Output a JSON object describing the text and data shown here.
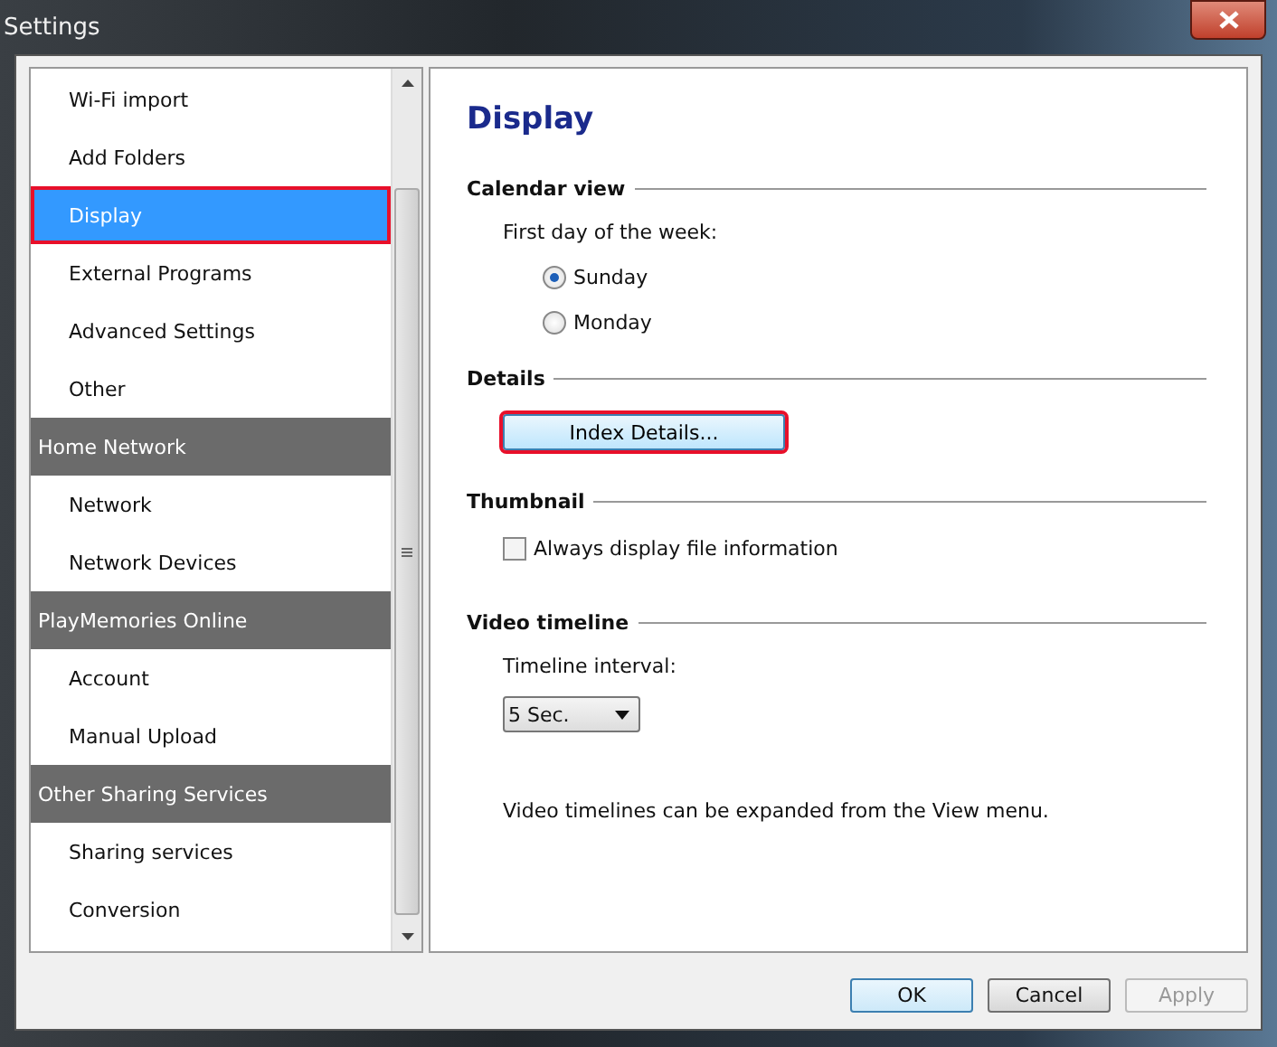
{
  "window": {
    "title": "Settings"
  },
  "sidebar": {
    "items": [
      {
        "kind": "item",
        "label": "Wi-Fi import",
        "selected": false,
        "highlighted": false
      },
      {
        "kind": "item",
        "label": "Add Folders",
        "selected": false,
        "highlighted": false
      },
      {
        "kind": "item",
        "label": "Display",
        "selected": true,
        "highlighted": true
      },
      {
        "kind": "item",
        "label": "External Programs",
        "selected": false,
        "highlighted": false
      },
      {
        "kind": "item",
        "label": "Advanced Settings",
        "selected": false,
        "highlighted": false
      },
      {
        "kind": "item",
        "label": "Other",
        "selected": false,
        "highlighted": false
      },
      {
        "kind": "header",
        "label": "Home Network"
      },
      {
        "kind": "item",
        "label": "Network",
        "selected": false,
        "highlighted": false
      },
      {
        "kind": "item",
        "label": "Network Devices",
        "selected": false,
        "highlighted": false
      },
      {
        "kind": "header",
        "label": "PlayMemories Online"
      },
      {
        "kind": "item",
        "label": "Account",
        "selected": false,
        "highlighted": false
      },
      {
        "kind": "item",
        "label": "Manual Upload",
        "selected": false,
        "highlighted": false
      },
      {
        "kind": "header",
        "label": "Other Sharing Services"
      },
      {
        "kind": "item",
        "label": "Sharing services",
        "selected": false,
        "highlighted": false
      },
      {
        "kind": "item",
        "label": "Conversion",
        "selected": false,
        "highlighted": false
      }
    ]
  },
  "page": {
    "title": "Display",
    "sections": [
      {
        "title": "Calendar view",
        "controls": [
          {
            "kind": "label",
            "text": "First day of the week:"
          },
          {
            "kind": "radio",
            "label": "Sunday",
            "selected": true
          },
          {
            "kind": "radio",
            "label": "Monday",
            "selected": false
          }
        ]
      },
      {
        "title": "Details",
        "controls": [
          {
            "kind": "button",
            "label": "Index Details...",
            "highlighted": true
          }
        ]
      },
      {
        "title": "Thumbnail",
        "controls": [
          {
            "kind": "checkbox",
            "label": "Always display file information",
            "checked": false
          }
        ]
      },
      {
        "title": "Video timeline",
        "controls": [
          {
            "kind": "label",
            "text": "Timeline interval:"
          },
          {
            "kind": "dropdown",
            "value": "5 Sec."
          },
          {
            "kind": "note",
            "text": "Video timelines can be expanded from the View menu."
          }
        ]
      }
    ]
  },
  "buttons": [
    {
      "label": "OK",
      "disabled": false,
      "default": true
    },
    {
      "label": "Cancel",
      "disabled": false,
      "default": false
    },
    {
      "label": "Apply",
      "disabled": true,
      "default": false
    }
  ]
}
